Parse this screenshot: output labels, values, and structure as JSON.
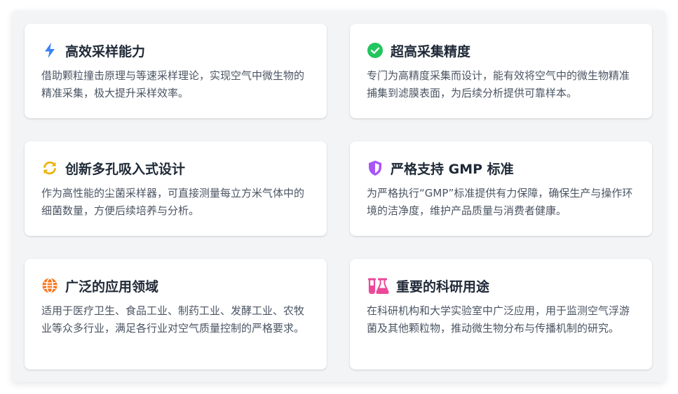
{
  "features": [
    {
      "title": "高效采样能力",
      "description": "借助颗粒撞击原理与等速采样理论，实现空气中微生物的精准采集，极大提升采样效率。",
      "icon": "bolt-icon",
      "color": "#3b82f6"
    },
    {
      "title": "超高采集精度",
      "description": "专门为高精度采集而设计，能有效将空气中的微生物精准捕集到滤膜表面，为后续分析提供可靠样本。",
      "icon": "check-circle-icon",
      "color": "#22c55e"
    },
    {
      "title": "创新多孔吸入式设计",
      "description": "作为高性能的尘菌采样器，可直接测量每立方米气体中的细菌数量，方便后续培养与分析。",
      "icon": "sync-arrows-icon",
      "color": "#eab308"
    },
    {
      "title": "严格支持 GMP 标准",
      "description": "为严格执行“GMP”标准提供有力保障，确保生产与操作环境的洁净度，维护产品质量与消费者健康。",
      "icon": "shield-icon",
      "color": "#a855f7"
    },
    {
      "title": "广泛的应用领域",
      "description": "适用于医疗卫生、食品工业、制药工业、发酵工业、农牧业等众多行业，满足各行业对空气质量控制的严格要求。",
      "icon": "globe-icon",
      "color": "#f97316"
    },
    {
      "title": "重要的科研用途",
      "description": "在科研机构和大学实验室中广泛应用，用于监测空气浮游菌及其他颗粒物，推动微生物分布与传播机制的研究。",
      "icon": "flask-icon",
      "color": "#ec4899"
    }
  ]
}
